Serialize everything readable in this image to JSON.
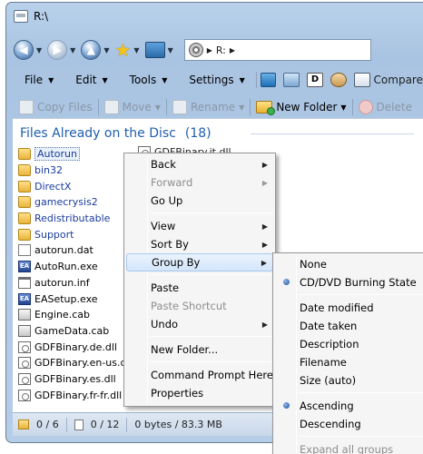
{
  "window": {
    "title": "R:\\"
  },
  "navigation": {
    "address_path": "R:",
    "address_separator": "▶",
    "address_trailing": "▶"
  },
  "menubar": {
    "items": [
      {
        "label": "File"
      },
      {
        "label": "Edit"
      },
      {
        "label": "Tools"
      },
      {
        "label": "Settings"
      }
    ],
    "compare_label": "Compare"
  },
  "commandbar": {
    "copy_files": "Copy Files",
    "move": "Move",
    "rename": "Rename",
    "new_folder": "New Folder",
    "delete": "Delete"
  },
  "filelist": {
    "heading": "Files Already on the Disc",
    "count": "(18)",
    "items": [
      {
        "name": "Autorun",
        "type": "folder"
      },
      {
        "name": "bin32",
        "type": "folder"
      },
      {
        "name": "DirectX",
        "type": "folder"
      },
      {
        "name": "gamecrysis2",
        "type": "folder"
      },
      {
        "name": "Redistributable",
        "type": "folder"
      },
      {
        "name": "Support",
        "type": "folder"
      },
      {
        "name": "autorun.dat",
        "type": "dat"
      },
      {
        "name": "AutoRun.exe",
        "type": "exe"
      },
      {
        "name": "autorun.inf",
        "type": "inf"
      },
      {
        "name": "EASetup.exe",
        "type": "exe"
      },
      {
        "name": "Engine.cab",
        "type": "cab"
      },
      {
        "name": "GameData.cab",
        "type": "cab"
      },
      {
        "name": "GDFBinary.de.dll",
        "type": "dll"
      },
      {
        "name": "GDFBinary.en-us.dll",
        "type": "dll"
      },
      {
        "name": "GDFBinary.es.dll",
        "type": "dll"
      },
      {
        "name": "GDFBinary.fr-fr.dll",
        "type": "dll"
      }
    ],
    "second_column_partial": "GDFBinary.it.dll"
  },
  "statusbar": {
    "folders": "0 / 6",
    "files": "0 / 12",
    "size": "0 bytes / 83.3 MB"
  },
  "context_menu": {
    "items": [
      {
        "label": "Back",
        "submenu": true,
        "disabled": false
      },
      {
        "label": "Forward",
        "submenu": true,
        "disabled": true
      },
      {
        "label": "Go Up",
        "submenu": false,
        "disabled": false
      },
      {
        "label": "View",
        "submenu": true,
        "disabled": false
      },
      {
        "label": "Sort By",
        "submenu": true,
        "disabled": false
      },
      {
        "label": "Group By",
        "submenu": true,
        "disabled": false,
        "highlighted": true
      },
      {
        "label": "Paste",
        "submenu": false,
        "disabled": false
      },
      {
        "label": "Paste Shortcut",
        "submenu": false,
        "disabled": true
      },
      {
        "label": "Undo",
        "submenu": true,
        "disabled": false
      },
      {
        "label": "New Folder...",
        "submenu": false,
        "disabled": false
      },
      {
        "label": "Command Prompt Here",
        "submenu": false,
        "disabled": false
      },
      {
        "label": "Properties",
        "submenu": false,
        "disabled": false
      }
    ]
  },
  "group_by_submenu": {
    "items": [
      {
        "label": "None",
        "checked": false
      },
      {
        "label": "CD/DVD Burning State",
        "checked": true
      },
      {
        "label": "Date modified",
        "checked": false
      },
      {
        "label": "Date taken",
        "checked": false
      },
      {
        "label": "Description",
        "checked": false
      },
      {
        "label": "Filename",
        "checked": false
      },
      {
        "label": "Size (auto)",
        "checked": false
      },
      {
        "label": "Ascending",
        "checked": true
      },
      {
        "label": "Descending",
        "checked": false
      },
      {
        "label": "Expand all groups",
        "checked": false,
        "disabled": true
      }
    ]
  }
}
